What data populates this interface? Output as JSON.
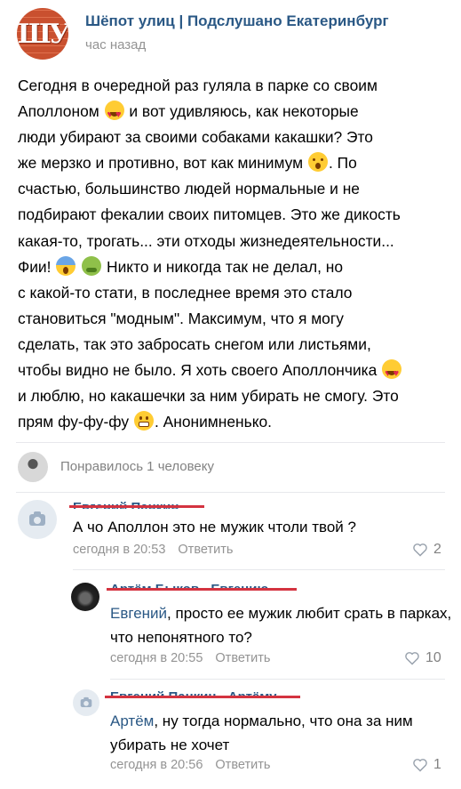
{
  "header": {
    "avatar_text": "ШУ",
    "group_name": "Шёпот улиц | Подслушано Екатеринбург",
    "time": "час назад"
  },
  "post": {
    "lines": [
      "Сегодня в очередной раз гуляла в парке со своим",
      "Аполлоном",
      "и вот удивляюсь, как некоторые",
      "люди убирают за своими собаками какашки? Это",
      "же мерзко и противно, вот как минимум",
      ". По",
      "счастью, большинство людей нормальные и не",
      "подбирают фекалии своих питомцев. Это же дикость",
      "какая-то, трогать... эти отходы жизнедеятельности...",
      "Фии!",
      "Никто и никогда так не делал, но",
      "с какой-то стати, в последнее время это стало",
      "становиться \"модным\". Максимум, что я могу",
      "сделать, так это забросать снегом или листьями,",
      "чтобы видно не было. Я хоть своего Аполлончика",
      "и люблю, но какашечки за ним убирать не смогу. Это",
      "прям фу-фу-фу",
      ". Анонимненько."
    ],
    "emojis": [
      "heart-eyes-emoji",
      "hushed-face-emoji",
      "scream-emoji",
      "nauseated-emoji",
      "heart-eyes-emoji",
      "grimace-emoji"
    ]
  },
  "likes": {
    "text": "Понравилось 1 человеку"
  },
  "comments": [
    {
      "author_redacted": "Евгений Панкин",
      "text": "А чо Аполлон это не мужик чтоли твой ?",
      "time": "сегодня в 20:53",
      "reply_label": "Ответить",
      "likes": "2"
    },
    {
      "author_redacted": "Артём Быков - Евгению",
      "reply_to": "Евгений",
      "text": ", просто ее мужик любит срать в парках, что непонятного то?",
      "time": "сегодня в 20:55",
      "reply_label": "Ответить",
      "likes": "10"
    },
    {
      "author_redacted": "Евгений Панкин - Артёму",
      "reply_to": "Артём",
      "text": ", ну тогда нормально, что она за ним убирать не хочет",
      "time": "сегодня в 20:56",
      "reply_label": "Ответить",
      "likes": "1"
    }
  ],
  "colors": {
    "link": "#2a5885",
    "meta": "#939393",
    "redaction": "#d43340"
  }
}
